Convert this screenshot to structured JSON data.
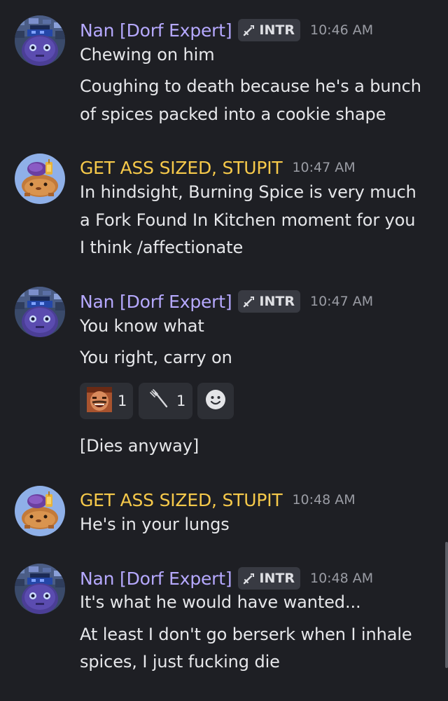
{
  "users": {
    "nan": {
      "name": "Nan [Dorf Expert]",
      "tag": "INTR",
      "name_color": "#b6a9ff"
    },
    "gas": {
      "name": "GET ASS SIZED, STUPIT",
      "name_color": "#f6c94a"
    }
  },
  "messages": [
    {
      "author": "Nan [Dorf Expert]",
      "tag": "INTR",
      "time": "10:46 AM",
      "lines": [
        "Chewing on him",
        "Coughing to death because he's a bunch",
        "of spices packed into a cookie shape"
      ]
    },
    {
      "author": "GET ASS SIZED, STUPIT",
      "time": "10:47 AM",
      "lines": [
        "In hindsight, Burning Spice is very much",
        "a Fork Found In Kitchen moment for you",
        "I think /affectionate"
      ]
    },
    {
      "author": "Nan [Dorf Expert]",
      "tag": "INTR",
      "time": "10:47 AM",
      "lines": [
        "You know what",
        "You right, carry on",
        "[Dies anyway]"
      ],
      "reactions": [
        {
          "emoji": "laughing-man-emoji",
          "count": "1"
        },
        {
          "emoji": "fork-emoji",
          "count": "1"
        }
      ]
    },
    {
      "author": "GET ASS SIZED, STUPIT",
      "time": "10:48 AM",
      "lines": [
        "He's in your lungs"
      ]
    },
    {
      "author": "Nan [Dorf Expert]",
      "tag": "INTR",
      "time": "10:48 AM",
      "lines": [
        "It's what he would have wanted...",
        "At least I don't go berserk when I inhale",
        "spices, I just fucking die"
      ]
    }
  ],
  "colors": {
    "background": "#1e1f24",
    "text": "#e6e7ea",
    "timestamp": "#9a9ca4",
    "tag_bg": "#383a42",
    "reaction_bg": "#2d2f35"
  }
}
